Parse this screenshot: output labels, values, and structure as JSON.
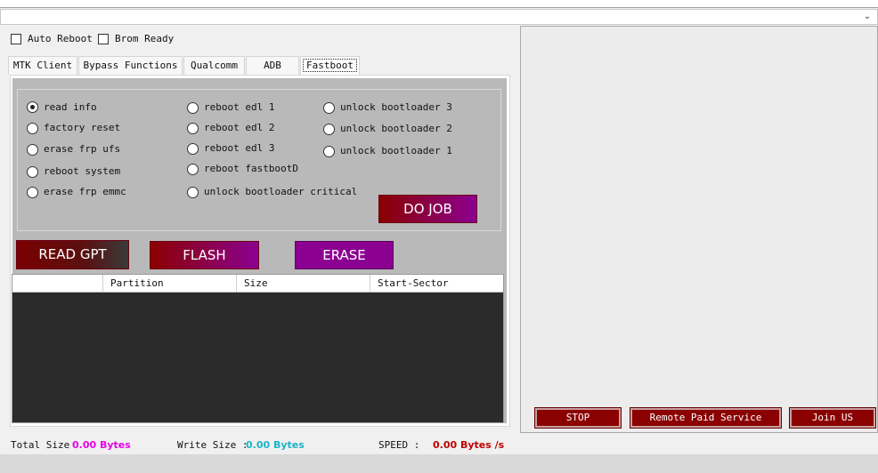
{
  "top": {
    "combo_value": "",
    "chevron_icon": "chevron-down-icon"
  },
  "options": {
    "auto_reboot": "Auto Reboot",
    "brom_ready": "Brom Ready",
    "auto_reboot_checked": false,
    "brom_ready_checked": false
  },
  "tabs": [
    {
      "label": "MTK Client"
    },
    {
      "label": "Bypass Functions"
    },
    {
      "label": "Qualcomm"
    },
    {
      "label": "ADB"
    },
    {
      "label": "Fastboot",
      "active": true
    }
  ],
  "radios": {
    "col1": [
      "read info",
      "factory reset",
      "erase frp ufs",
      "reboot system",
      "erase frp emmc"
    ],
    "col2": [
      "reboot edl 1",
      "reboot edl 2",
      "reboot edl 3",
      "reboot fastbootD",
      "unlock bootloader critical"
    ],
    "col3": [
      "unlock bootloader 3",
      "unlock bootloader 2",
      "unlock bootloader 1"
    ],
    "selected": "read info"
  },
  "buttons": {
    "do_job": "DO JOB",
    "read_gpt": "READ GPT",
    "flash": "FLASH",
    "erase": "ERASE"
  },
  "table": {
    "columns": [
      "",
      "Partition",
      "Size",
      "Start-Sector"
    ]
  },
  "right": {
    "stop": "STOP",
    "remote": "Remote Paid Service",
    "join": "Join US"
  },
  "status": {
    "total_label": "Total Size",
    "total_value": "0.00 Bytes",
    "write_label": "Write Size :",
    "write_value": "0.00 Bytes",
    "speed_label": "SPEED :",
    "speed_value": "0.00 Bytes /s"
  },
  "colors": {
    "total": "#e600e6",
    "write": "#19b5c8",
    "speed": "#c00000",
    "btn_red": "#8b0000",
    "btn_purple": "#8b0090"
  }
}
